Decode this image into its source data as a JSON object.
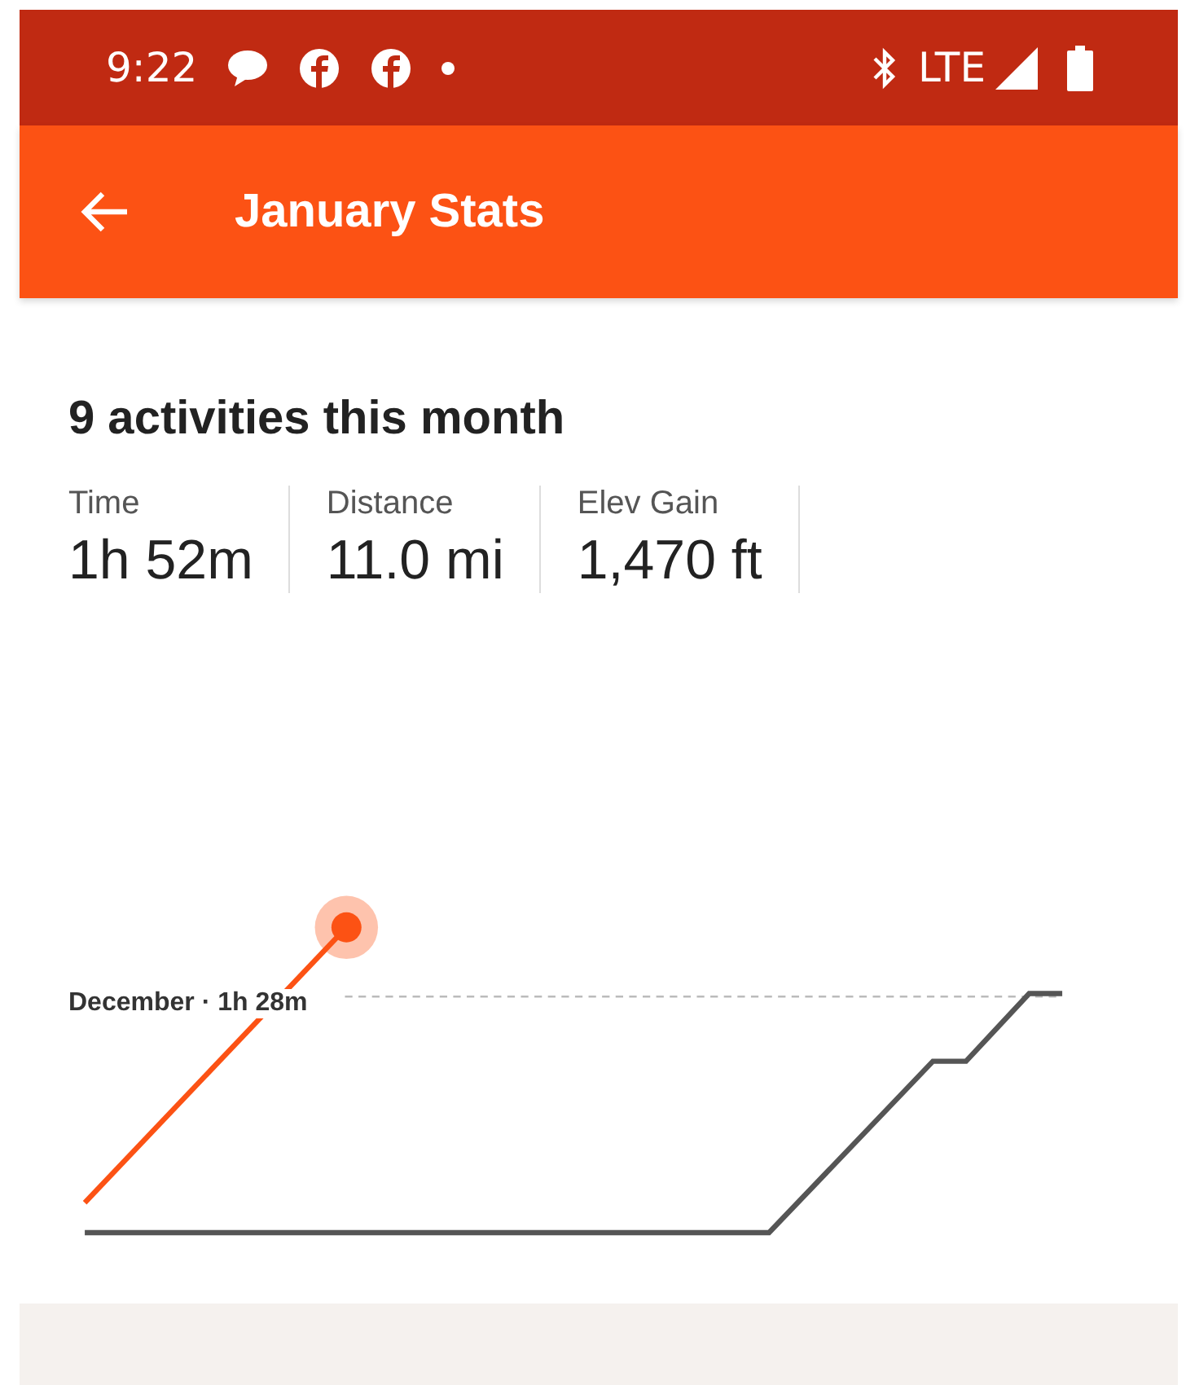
{
  "status_bar": {
    "time": "9:22",
    "network": "LTE"
  },
  "app_bar": {
    "title": "January Stats"
  },
  "summary": {
    "title": "9 activities this month",
    "stats": [
      {
        "label": "Time",
        "value": "1h 52m"
      },
      {
        "label": "Distance",
        "value": "11.0 mi"
      },
      {
        "label": "Elev Gain",
        "value": "1,470 ft"
      }
    ]
  },
  "chart": {
    "kind": "picture",
    "reference_label": "December · 1h 28m"
  }
}
